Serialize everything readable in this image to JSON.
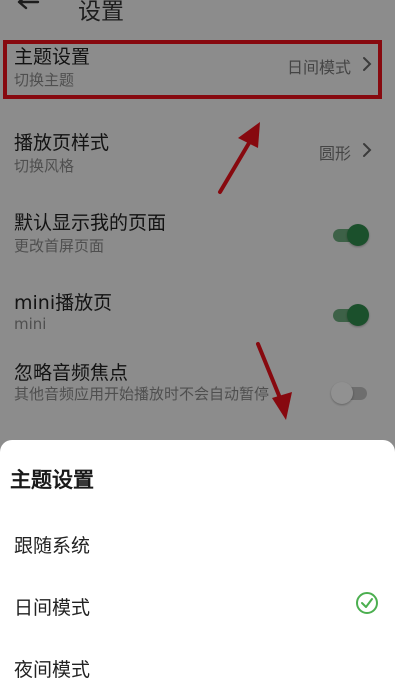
{
  "header": {
    "title": "设置"
  },
  "settings": {
    "theme": {
      "title": "主题设置",
      "subtitle": "切换主题",
      "value": "日间模式"
    },
    "player_style": {
      "title": "播放页样式",
      "subtitle": "切换风格",
      "value": "圆形"
    },
    "default_my_page": {
      "title": "默认显示我的页面",
      "subtitle": "更改首屏页面",
      "enabled": true
    },
    "mini_player": {
      "title": "mini播放页",
      "subtitle": "mini",
      "enabled": true
    },
    "ignore_audio_focus": {
      "title": "忽略音频焦点",
      "subtitle": "其他音频应用开始播放时不会自动暂停",
      "enabled": false
    }
  },
  "sheet": {
    "title": "主题设置",
    "options": [
      {
        "label": "跟随系统",
        "selected": false
      },
      {
        "label": "日间模式",
        "selected": true
      },
      {
        "label": "夜间模式",
        "selected": false
      }
    ]
  },
  "colors": {
    "highlight": "#e8111a",
    "toggle_on": "#2f8a4c",
    "check": "#4caf50"
  }
}
